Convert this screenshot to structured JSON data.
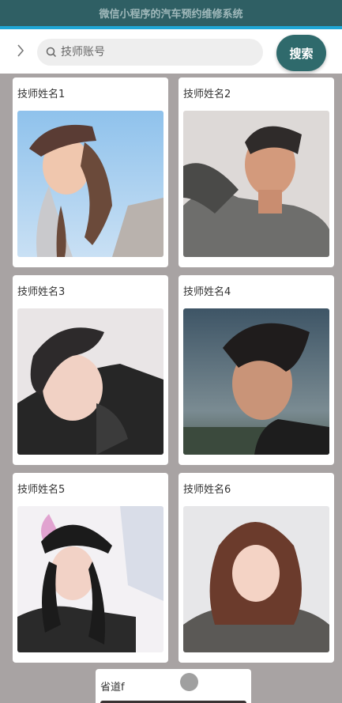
{
  "app": {
    "title": "微信小程序的汽车预约维修系统"
  },
  "search": {
    "placeholder": "技师账号",
    "button_label": "搜索"
  },
  "back_icon": "chevron-right-icon",
  "colors": {
    "header": "#2f5f64",
    "accent": "#1fa7d6",
    "button": "#2f6a6c",
    "background": "#a8a3a3"
  },
  "technicians": [
    {
      "name": "技师姓名1"
    },
    {
      "name": "技师姓名2"
    },
    {
      "name": "技师姓名3"
    },
    {
      "name": "技师姓名4"
    },
    {
      "name": "技师姓名5"
    },
    {
      "name": "技师姓名6"
    }
  ],
  "partial_card": {
    "name": "省道f"
  }
}
